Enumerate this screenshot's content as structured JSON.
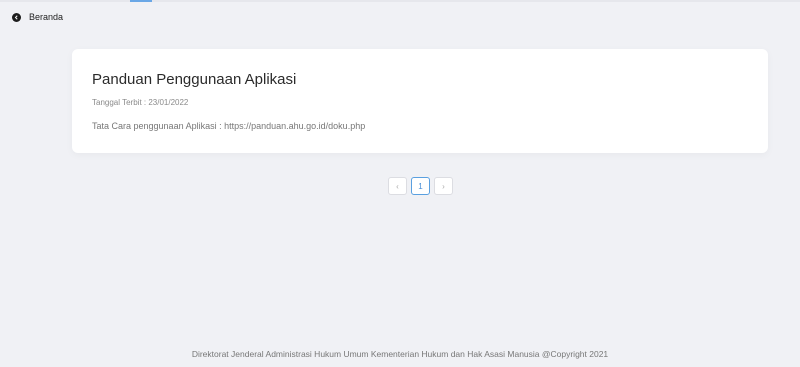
{
  "nav": {
    "back_label": "Beranda"
  },
  "announcement": {
    "title": "Panduan Penggunaan Aplikasi",
    "published": "Tanggal Terbit : 23/01/2022",
    "description": "Tata Cara penggunaan Aplikasi : https://panduan.ahu.go.id/doku.php"
  },
  "pagination": {
    "prev": "‹",
    "current": "1",
    "next": "›"
  },
  "footer": {
    "copyright": "Direktorat Jenderal Administrasi Hukum Umum Kementerian Hukum dan Hak Asasi Manusia @Copyright 2021"
  },
  "colors": {
    "background": "#f0f1f5",
    "card": "#ffffff",
    "accent": "#5aa0e0"
  },
  "icons": {
    "back": "chevron-left-circle-icon"
  }
}
